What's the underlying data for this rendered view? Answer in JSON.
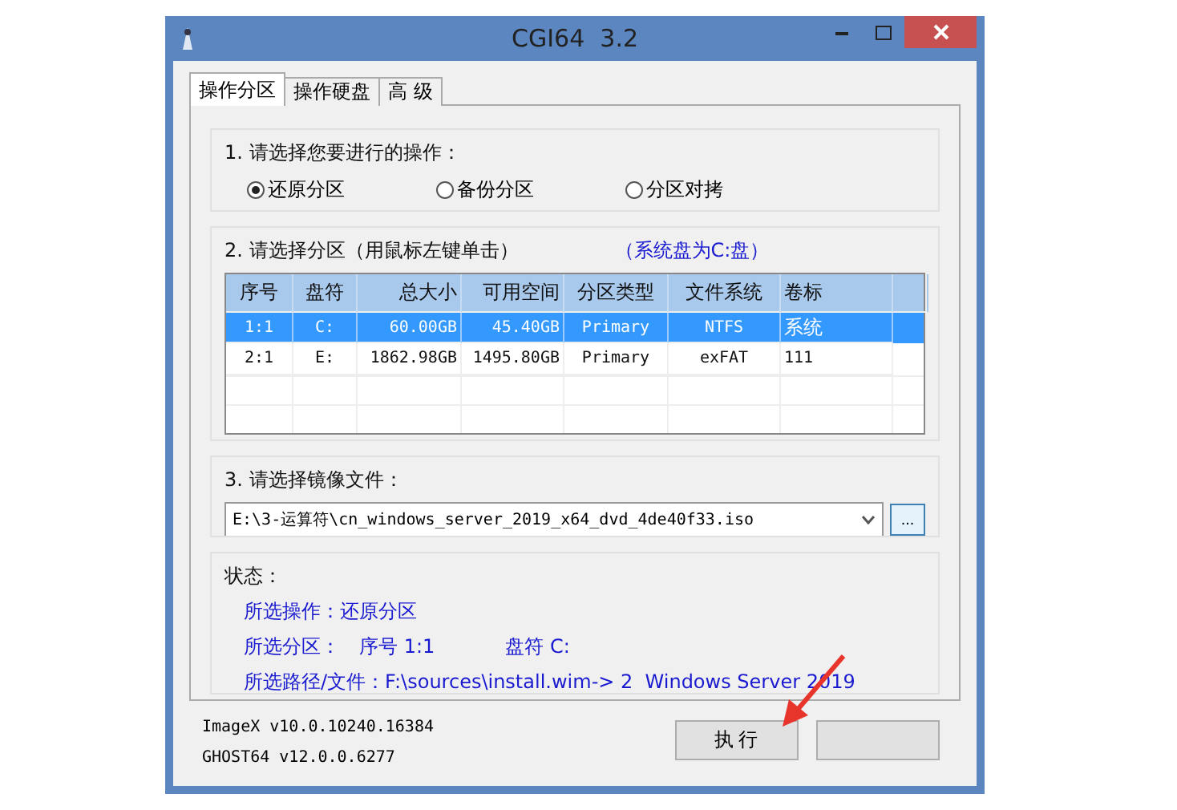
{
  "window": {
    "title": "CGI64  3.2"
  },
  "tabs": [
    {
      "label": "操作分区",
      "selected": true
    },
    {
      "label": "操作硬盘",
      "selected": false
    },
    {
      "label": "高 级",
      "selected": false
    }
  ],
  "operation": {
    "label": "1. 请选择您要进行的操作：",
    "options": [
      {
        "label": "还原分区",
        "selected": true
      },
      {
        "label": "备份分区",
        "selected": false
      },
      {
        "label": "分区对拷",
        "selected": false
      }
    ]
  },
  "partition": {
    "label": "2. 请选择分区（用鼠标左键单击）",
    "note": "（系统盘为C:盘）",
    "columns": [
      "序号",
      "盘符",
      "总大小",
      "可用空间",
      "分区类型",
      "文件系统",
      "卷标"
    ],
    "rows": [
      {
        "cells": [
          "1:1",
          "C:",
          "60.00GB",
          "45.40GB",
          "Primary",
          "NTFS",
          "系统"
        ],
        "selected": true
      },
      {
        "cells": [
          "2:1",
          "E:",
          "1862.98GB",
          "1495.80GB",
          "Primary",
          "exFAT",
          "111"
        ],
        "selected": false
      }
    ]
  },
  "image": {
    "label": "3. 请选择镜像文件：",
    "value": "E:\\3-运算符\\cn_windows_server_2019_x64_dvd_4de40f33.iso",
    "browse": "..."
  },
  "status": {
    "label": "状态：",
    "lines": [
      [
        "所选操作：还原分区"
      ],
      [
        "所选分区：",
        "序号 1:1",
        "盘符 C:"
      ],
      [
        "所选路径/文件：F:\\sources\\install.wim-> 2  Windows Server 2019"
      ]
    ]
  },
  "versions": [
    "ImageX v10.0.10240.16384",
    "GHOST64 v12.0.0.6277"
  ],
  "buttons": [
    "执 行"
  ]
}
